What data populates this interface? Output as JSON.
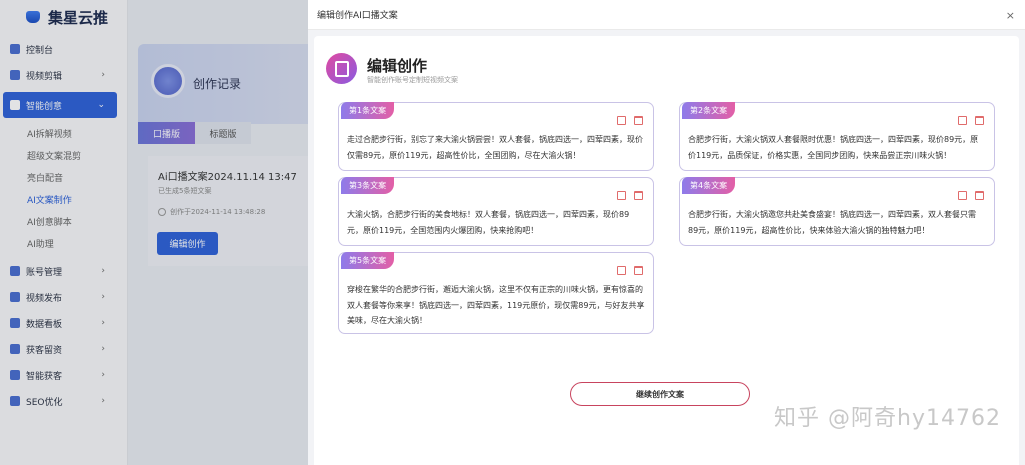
{
  "app": {
    "name": "集星云推"
  },
  "sidebar": {
    "items": [
      {
        "label": "控制台",
        "chevron": ""
      },
      {
        "label": "视频剪辑",
        "chevron": "›"
      },
      {
        "label": "智能创意",
        "chevron": "⌄"
      },
      {
        "label": "账号管理",
        "chevron": "›"
      },
      {
        "label": "视频发布",
        "chevron": "›"
      },
      {
        "label": "数据看板",
        "chevron": "›"
      },
      {
        "label": "获客留资",
        "chevron": "›"
      },
      {
        "label": "智能获客",
        "chevron": "›"
      },
      {
        "label": "SEO优化",
        "chevron": "›"
      }
    ],
    "sub_items": [
      "AI拆解视频",
      "超级文案混剪",
      "亮白配音",
      "AI文案制作",
      "AI创意脚本",
      "AI助理"
    ]
  },
  "background": {
    "record_title": "创作记录",
    "tabs": [
      "口播版",
      "标题版"
    ],
    "work": {
      "title": "Ai口播文案2024.11.14 13:47",
      "subtitle": "已生成5条短文案",
      "time": "创作于2024-11-14 13:48:28",
      "edit_button": "编辑创作"
    }
  },
  "drawer": {
    "header": "编辑创作AI口播文案",
    "close": "×",
    "panel_title": "编辑创作",
    "panel_subtitle": "智能创作账号定制短视频文案",
    "copies": [
      {
        "label": "第1条文案",
        "text": "走过合肥步行街，别忘了来大渝火锅尝尝！双人套餐，锅底四选一，四荤四素，现价仅需89元，原价119元，超高性价比，全国团购，尽在大渝火锅！"
      },
      {
        "label": "第2条文案",
        "text": "合肥步行街，大渝火锅双人套餐限时优惠！锅底四选一，四荤四素，现价89元，原价119元，品质保证，价格实惠，全国同步团购，快来品尝正宗川味火锅！"
      },
      {
        "label": "第3条文案",
        "text": "大渝火锅，合肥步行街的美食地标！双人套餐，锅底四选一，四荤四素，现价89元，原价119元，全国范围内火爆团购，快来抢购吧！"
      },
      {
        "label": "第4条文案",
        "text": "合肥步行街，大渝火锅邀您共赴美食盛宴！锅底四选一，四荤四素，双人套餐只需89元，原价119元，超高性价比，快来体验大渝火锅的独特魅力吧！"
      },
      {
        "label": "第5条文案",
        "text": "穿梭在繁华的合肥步行街，邂逅大渝火锅，这里不仅有正宗的川味火锅，更有惊喜的双人套餐等你来享！锅底四选一，四荤四素，119元原价，现仅需89元，与好友共享美味，尽在大渝火锅！"
      }
    ],
    "continue_button": "继续创作文案"
  },
  "watermark": "知乎 @阿奇hy14762"
}
